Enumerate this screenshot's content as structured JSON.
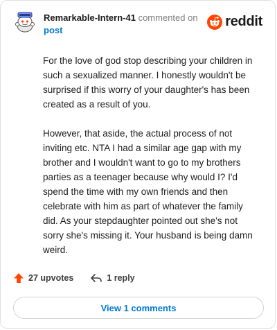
{
  "comment": {
    "username": "Remarkable-Intern-41",
    "action_text": "commented on",
    "link_text": "post",
    "paragraphs": [
      "For the love of god stop describing your children in such a sexualized manner. I honestly wouldn't be surprised if this worry of your daughter's has been created as a result of you.",
      "However, that aside, the actual process of not inviting etc. NTA I had a similar age gap with my brother and I wouldn't want to go to my brothers parties as a teenager because why would I? I'd spend the time with my own friends and then celebrate with him as part of whatever the family did. As your stepdaughter pointed out she's not sorry she's missing it. Your husband is being damn weird."
    ]
  },
  "brand": {
    "logo_text": "reddit",
    "accent_color": "#ff4500"
  },
  "actions": {
    "upvotes_label": "27 upvotes",
    "reply_label": "1 reply",
    "view_comments_label": "View 1 comments",
    "upvote_icon": "upvote-arrow-icon",
    "reply_icon": "reply-arrow-icon"
  }
}
